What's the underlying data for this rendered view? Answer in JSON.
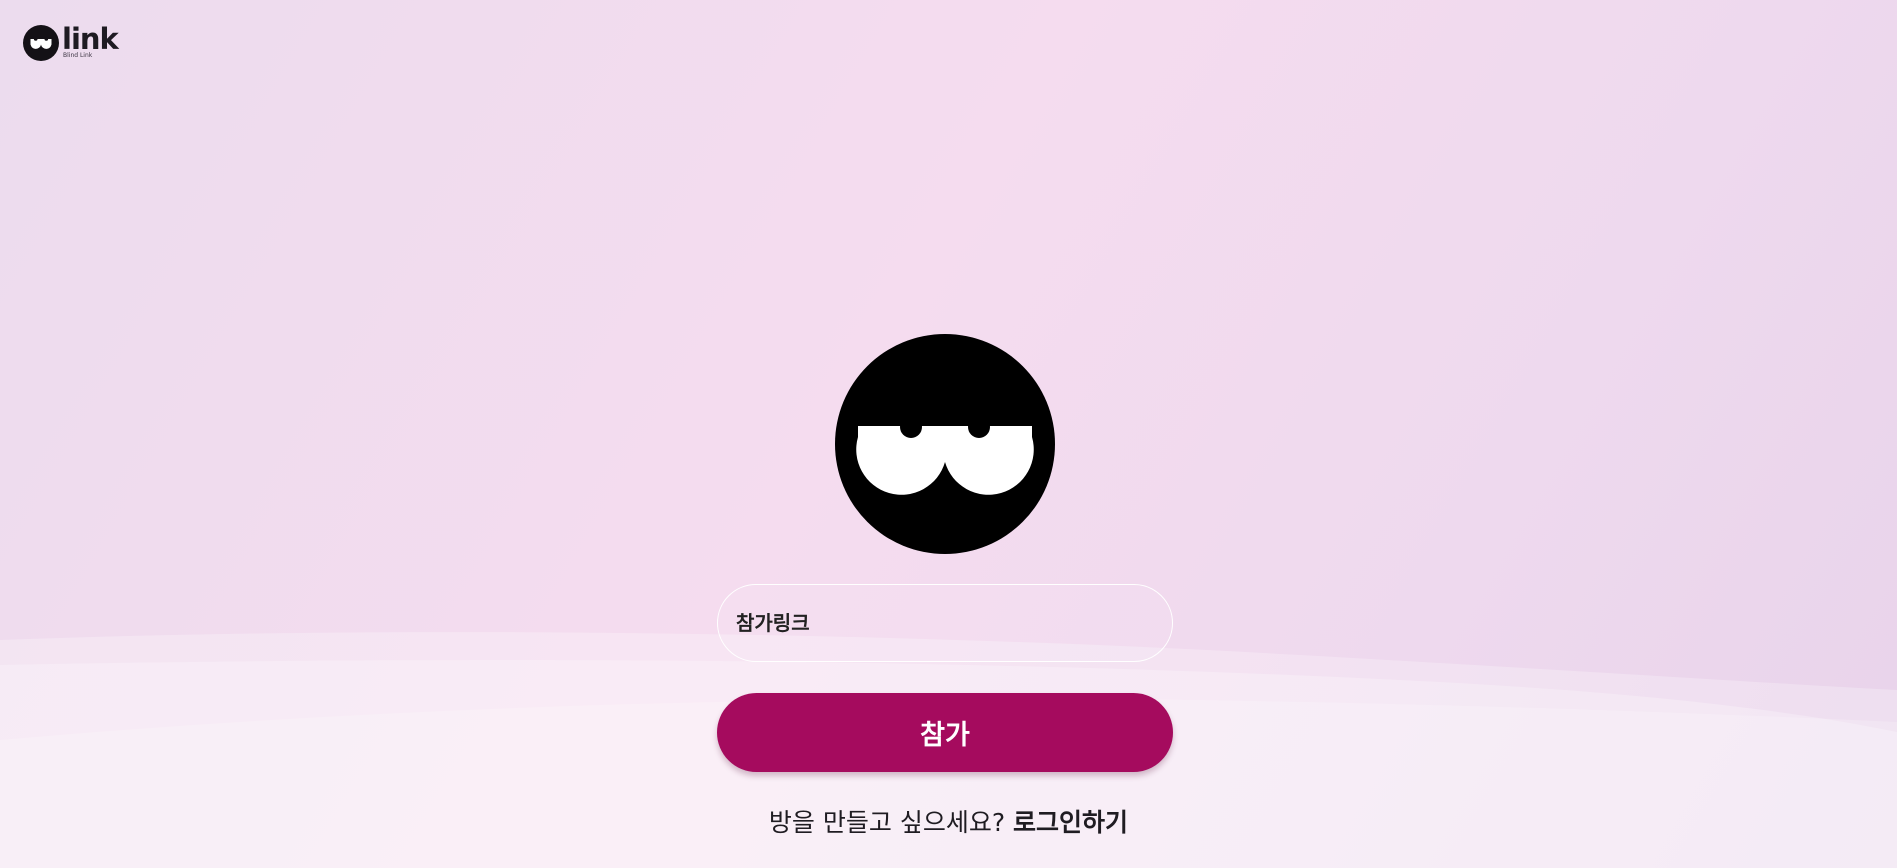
{
  "header": {
    "logo_word": "link",
    "logo_subtitle": "Blind Link"
  },
  "hero": {
    "icon": "blink-eyes-icon"
  },
  "join_form": {
    "link_placeholder": "참가링크",
    "join_label": "참가"
  },
  "footer": {
    "prompt": "방을 만들고 싶으세요?",
    "login_label": "로그인하기"
  },
  "colors": {
    "accent": "#a50b5e",
    "icon": "#000000",
    "background": "#f3dcef"
  }
}
